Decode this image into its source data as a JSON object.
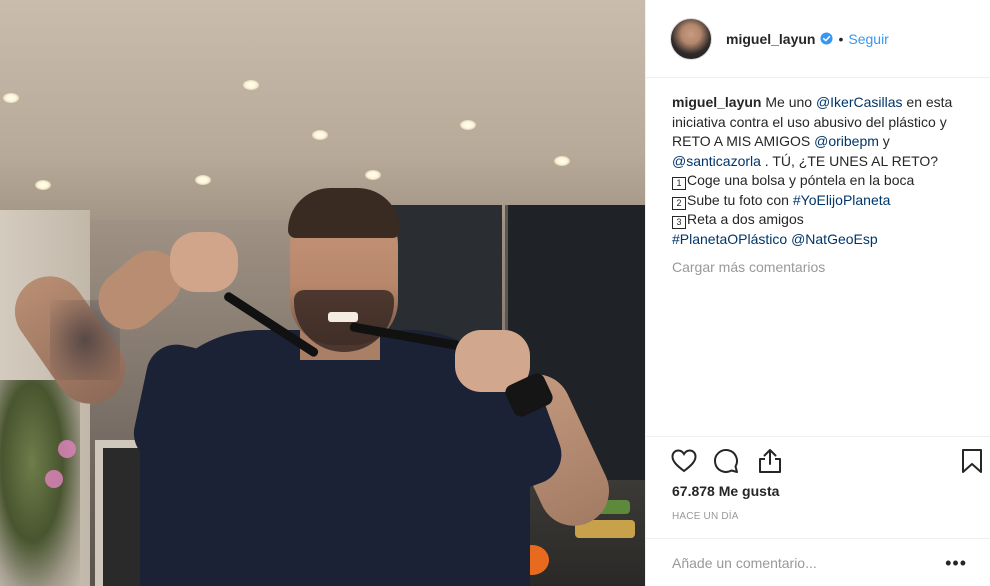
{
  "photo": {
    "alt_icon": "photo"
  },
  "header": {
    "username": "miguel_layun",
    "verified": "verified-badge-icon",
    "separator": "•",
    "follow_label": "Seguir"
  },
  "caption": {
    "username": "miguel_layun",
    "lines": [
      {
        "parts": [
          {
            "t": "Me uno "
          },
          {
            "t": "@IkerCasillas",
            "link": true
          },
          {
            "t": " en esta"
          }
        ]
      },
      {
        "parts": [
          {
            "t": "iniciativa contra el uso abusivo del plástico y"
          }
        ]
      },
      {
        "parts": [
          {
            "t": "RETO A MIS AMIGOS "
          },
          {
            "t": "@oribepm",
            "link": true
          },
          {
            "t": " y"
          }
        ]
      },
      {
        "parts": [
          {
            "t": "@santicazorla",
            "link": true
          },
          {
            "t": " . TÚ, ¿TE UNES AL RETO?"
          }
        ]
      },
      {
        "parts": [
          {
            "emoji": "1"
          },
          {
            "t": "Coge una bolsa y póntela en la boca"
          }
        ]
      },
      {
        "parts": [
          {
            "emoji": "2"
          },
          {
            "t": "Sube tu foto con "
          },
          {
            "t": "#YoElijoPlaneta",
            "link": true
          }
        ]
      },
      {
        "parts": [
          {
            "emoji": "3"
          },
          {
            "t": "Reta a dos amigos"
          }
        ]
      },
      {
        "parts": [
          {
            "t": "#PlanetaOPlástico",
            "link": true
          },
          {
            "t": " "
          },
          {
            "t": "@NatGeoEsp",
            "link": true
          }
        ]
      }
    ]
  },
  "load_more_label": "Cargar más comentarios",
  "actions": {
    "like": "heart-icon",
    "comment": "comment-bubble-icon",
    "share": "share-icon",
    "save": "bookmark-icon"
  },
  "likes_text": "67.878 Me gusta",
  "time_ago": "HACE UN DÍA",
  "comment": {
    "placeholder": "Añade un comentario...",
    "more_label": "•••"
  },
  "colors": {
    "link": "#003569",
    "follow": "#3897f0",
    "muted": "#999999",
    "text": "#262626",
    "border": "#efefef"
  }
}
